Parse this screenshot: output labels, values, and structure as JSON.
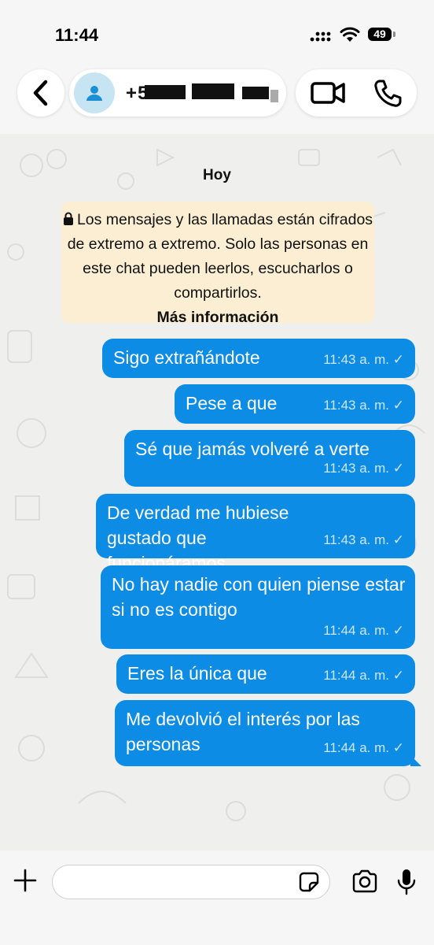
{
  "status": {
    "time": "11:44",
    "battery": "49"
  },
  "header": {
    "back_icon": "chevron-left-icon",
    "contact_name": "+5",
    "avatar_icon": "person-icon",
    "video_icon": "video-camera-icon",
    "phone_icon": "phone-icon"
  },
  "chat": {
    "date": "Hoy",
    "encryption": {
      "text": "Los mensajes y las llamadas están cifrados de extremo a extremo. Solo las personas en este chat pueden leerlos, escucharlos o compartirlos.",
      "link": "Más información",
      "icon": "lock-icon"
    },
    "messages": [
      {
        "text": "Sigo extrañándote",
        "time": "11:43 a. m."
      },
      {
        "text": "Pese a que",
        "time": "11:43 a. m."
      },
      {
        "text": "Sé que jamás volveré a verte",
        "time": "11:43 a. m."
      },
      {
        "text": "De verdad me hubiese gustado que funcionáramos",
        "time": "11:43 a. m."
      },
      {
        "text": "No hay nadie con quien piense estar si no es contigo",
        "time": "11:44 a. m."
      },
      {
        "text": "Eres la única que",
        "time": "11:44 a. m."
      },
      {
        "text": "Me devolvió el interés por las personas",
        "time": "11:44 a. m."
      }
    ],
    "tick": "✓"
  },
  "composer": {
    "input_value": "",
    "icons": [
      "plus-icon",
      "sticker-icon",
      "camera-icon",
      "microphone-icon"
    ]
  },
  "colors": {
    "bubble": "#0d8ce6",
    "encryption_bg": "#fbeed3",
    "avatar_bg": "#c7e4f3"
  }
}
